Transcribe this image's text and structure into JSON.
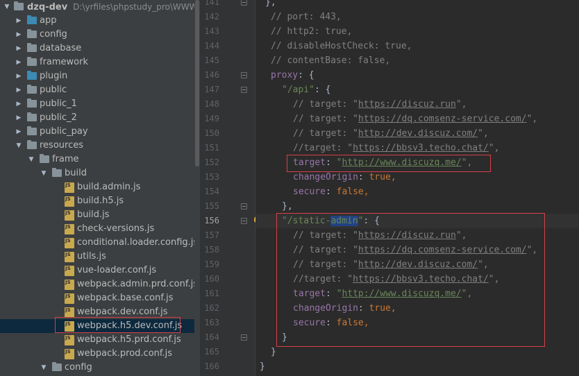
{
  "project_tree": {
    "root": {
      "name": "dzq-dev",
      "path": "D:\\yrfiles\\phpstudy_pro\\WWW\\dz"
    },
    "items": [
      {
        "label": "app",
        "kind": "folder",
        "color": "blue",
        "expanded": false
      },
      {
        "label": "config",
        "kind": "folder",
        "color": "gray",
        "expanded": false
      },
      {
        "label": "database",
        "kind": "folder",
        "color": "gray",
        "expanded": false
      },
      {
        "label": "framework",
        "kind": "folder",
        "color": "gray",
        "expanded": false
      },
      {
        "label": "plugin",
        "kind": "folder",
        "color": "blue",
        "expanded": false
      },
      {
        "label": "public",
        "kind": "folder",
        "color": "gray",
        "expanded": false
      },
      {
        "label": "public_1",
        "kind": "folder",
        "color": "gray",
        "expanded": false
      },
      {
        "label": "public_2",
        "kind": "folder",
        "color": "gray",
        "expanded": false
      },
      {
        "label": "public_pay",
        "kind": "folder",
        "color": "gray",
        "expanded": false
      },
      {
        "label": "resources",
        "kind": "folder",
        "color": "gray",
        "expanded": true
      },
      {
        "label": "frame",
        "kind": "folder",
        "color": "gray",
        "expanded": true
      },
      {
        "label": "build",
        "kind": "folder",
        "color": "gray",
        "expanded": true
      },
      {
        "label": "build.admin.js",
        "kind": "file",
        "icon": "js-file-icon"
      },
      {
        "label": "build.h5.js",
        "kind": "file",
        "icon": "js-file-icon"
      },
      {
        "label": "build.js",
        "kind": "file",
        "icon": "js-file-icon"
      },
      {
        "label": "check-versions.js",
        "kind": "file",
        "icon": "js-file-icon"
      },
      {
        "label": "conditional.loader.config.js",
        "kind": "file",
        "icon": "js-file-icon"
      },
      {
        "label": "utils.js",
        "kind": "file",
        "icon": "js-file-icon"
      },
      {
        "label": "vue-loader.conf.js",
        "kind": "file",
        "icon": "js-file-icon"
      },
      {
        "label": "webpack.admin.prd.conf.js",
        "kind": "file",
        "icon": "js-file-icon"
      },
      {
        "label": "webpack.base.conf.js",
        "kind": "file",
        "icon": "js-file-icon"
      },
      {
        "label": "webpack.dev.conf.js",
        "kind": "file",
        "icon": "js-file-icon"
      },
      {
        "label": "webpack.h5.dev.conf.js",
        "kind": "file",
        "icon": "js-file-icon",
        "selected": true
      },
      {
        "label": "webpack.h5.prd.conf.js",
        "kind": "file",
        "icon": "js-file-icon"
      },
      {
        "label": "webpack.prod.conf.js",
        "kind": "file",
        "icon": "js-file-icon"
      },
      {
        "label": "config",
        "kind": "folder",
        "color": "gray",
        "expanded": true
      }
    ],
    "file_icon_text": "JS",
    "colors": {
      "folder_gray": "#87939a",
      "folder_blue": "#3d8ab4",
      "selection": "#0d293e",
      "highlight_outline": "#d6404a"
    }
  },
  "editor": {
    "current_line": "156",
    "line_numbers": [
      "141",
      "142",
      "143",
      "144",
      "145",
      "146",
      "147",
      "148",
      "149",
      "150",
      "151",
      "152",
      "153",
      "154",
      "155",
      "156",
      "157",
      "158",
      "159",
      "160",
      "161",
      "162",
      "163",
      "164",
      "165",
      "166"
    ],
    "code": {
      "l141": "},",
      "l142": "// port: 443,",
      "l143": "// http2: true,",
      "l144": "// disableHostCheck: true,",
      "l145": "// contentBase: false,",
      "l146_key": "proxy",
      "l146_rest": ": {",
      "l147_str": "\"/api\"",
      "l147_rest": ": {",
      "t_prefix": "// target: \"",
      "t_suffix": "\",",
      "url_run": "https://discuz.run",
      "url_comsenz": "https://dq.comsenz-service.com/",
      "url_dev": "http://dev.discuz.com/",
      "l151_prefix": "//target: \"",
      "url_techo": "https://bbsv3.techo.chat/",
      "target_key": "target",
      "colon": ": ",
      "quote": "\"",
      "url_active": "http://www.discuzq.me/",
      "str_end": "\",",
      "change_key": "changeOrigin",
      "secure_key": "secure",
      "kw_true": "true",
      "kw_false": "false",
      "comma": ",",
      "l155": "},",
      "l156_str_a": "\"/static-",
      "l156_sel": "admin",
      "l156_str_b": "\"",
      "l156_rest": ": {",
      "l164": "}",
      "l165": "}",
      "l166": "}"
    },
    "colors": {
      "string": "#6a8759",
      "keyword": "#cc7832",
      "comment": "#808080",
      "property": "#9876aa",
      "text": "#a9b7c6",
      "selection": "#214283"
    },
    "gutter_icons": [
      "fold-marker-icon",
      "lightbulb-icon"
    ]
  }
}
